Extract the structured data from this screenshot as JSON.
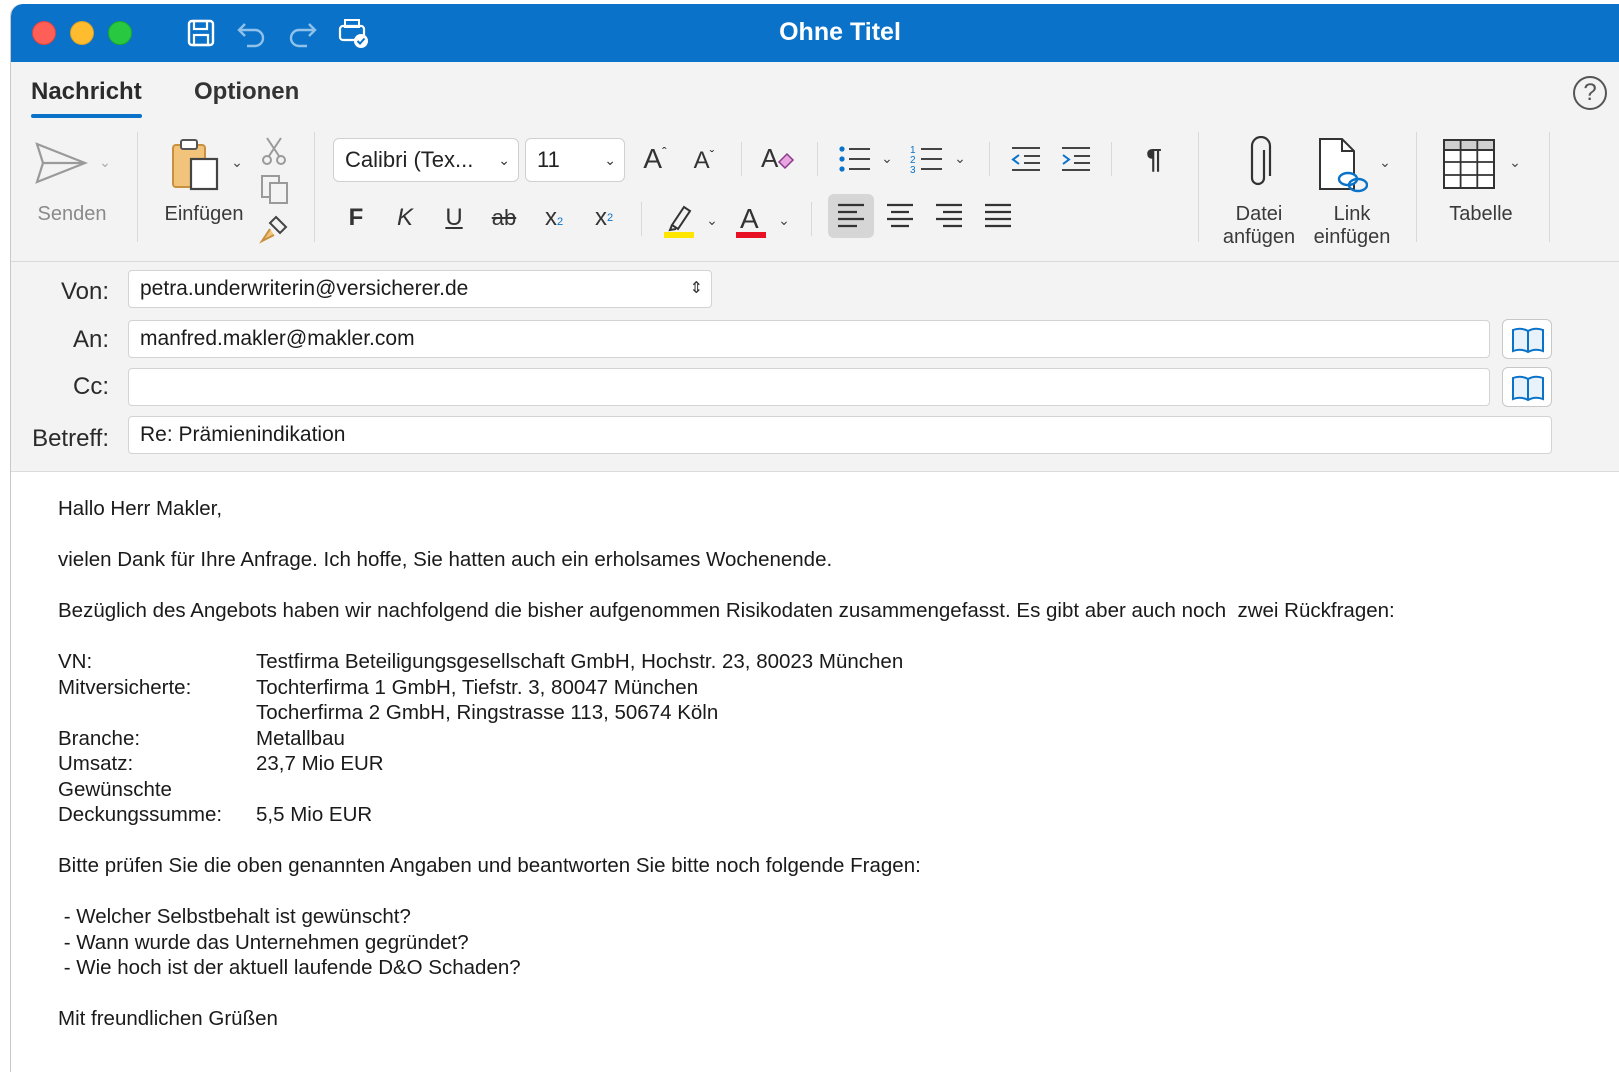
{
  "window": {
    "title": "Ohne Titel"
  },
  "tabs": [
    {
      "label": "Nachricht"
    },
    {
      "label": "Optionen"
    }
  ],
  "help_label": "?",
  "ribbon": {
    "send_label": "Senden",
    "paste_label": "Einfügen",
    "font_family": "Calibri (Tex...",
    "font_size": "11",
    "bold": "F",
    "italic": "K",
    "underline": "U",
    "strikethrough": "ab",
    "subscript": "x",
    "superscript": "x",
    "attach_file_label_1": "Datei",
    "attach_file_label_2": "anfügen",
    "insert_link_label_1": "Link",
    "insert_link_label_2": "einfügen",
    "table_label": "Tabelle",
    "colors": {
      "highlight": "#ffe600",
      "font_color": "#e81123",
      "accent": "#0a72c8"
    }
  },
  "header": {
    "from_label": "Von:",
    "from_value": "petra.underwriterin@versicherer.de",
    "to_label": "An:",
    "to_value": "manfred.makler@makler.com",
    "cc_label": "Cc:",
    "cc_value": "",
    "subject_label": "Betreff:",
    "subject_value": "Re: Prämienindikation"
  },
  "body": {
    "greeting": "Hallo Herr Makler,",
    "p1": "vielen Dank für Ihre Anfrage. Ich hoffe, Sie hatten auch ein erholsames Wochenende.",
    "p2": "Bezüglich des Angebots haben wir nachfolgend die bisher aufgenommen Risikodaten zusammengefasst. Es gibt aber auch noch  zwei Rückfragen:",
    "data": [
      {
        "key": "VN:",
        "value": "Testfirma Beteiligungsgesellschaft GmbH, Hochstr. 23, 80023 München"
      },
      {
        "key": "Mitversicherte:",
        "value": "Tochterfirma 1 GmbH, Tiefstr. 3, 80047 München"
      },
      {
        "key": "",
        "value": "Tocherfirma 2 GmbH, Ringstrasse 113, 50674 Köln"
      },
      {
        "key": "Branche:",
        "value": "Metallbau"
      },
      {
        "key": "Umsatz:",
        "value": "23,7 Mio EUR"
      },
      {
        "key": "Gewünschte",
        "value": ""
      },
      {
        "key": "Deckungssumme:",
        "value": "5,5 Mio EUR"
      }
    ],
    "p3": "Bitte prüfen Sie die oben genannten Angaben und beantworten Sie bitte noch folgende Fragen:",
    "questions": [
      " - Welcher Selbstbehalt ist gewünscht?",
      " - Wann wurde das Unternehmen gegründet?",
      " - Wie hoch ist der aktuell laufende D&O Schaden?"
    ],
    "closing": "Mit freundlichen Grüßen"
  }
}
